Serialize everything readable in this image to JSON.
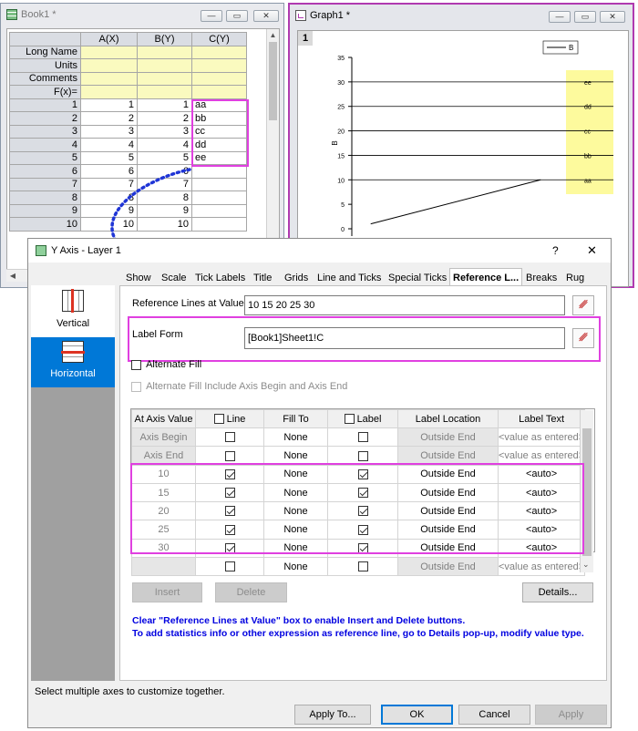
{
  "book": {
    "title": "Book1 *",
    "columns": [
      "A(X)",
      "B(Y)",
      "C(Y)"
    ],
    "meta_rows": [
      "Long Name",
      "Units",
      "Comments",
      "F(x)="
    ],
    "rows": [
      {
        "n": "1",
        "a": "1",
        "b": "1",
        "c": "aa"
      },
      {
        "n": "2",
        "a": "2",
        "b": "2",
        "c": "bb"
      },
      {
        "n": "3",
        "a": "3",
        "b": "3",
        "c": "cc"
      },
      {
        "n": "4",
        "a": "4",
        "b": "4",
        "c": "dd"
      },
      {
        "n": "5",
        "a": "5",
        "b": "5",
        "c": "ee"
      },
      {
        "n": "6",
        "a": "6",
        "b": "6",
        "c": ""
      },
      {
        "n": "7",
        "a": "7",
        "b": "7",
        "c": ""
      },
      {
        "n": "8",
        "a": "8",
        "b": "8",
        "c": ""
      },
      {
        "n": "9",
        "a": "9",
        "b": "9",
        "c": ""
      },
      {
        "n": "10",
        "a": "10",
        "b": "10",
        "c": ""
      }
    ]
  },
  "graph": {
    "title": "Graph1 *",
    "layer": "1",
    "legend": "B",
    "ylabel": "B",
    "yticks": [
      "35",
      "30",
      "25",
      "20",
      "15",
      "10",
      "5",
      "0"
    ],
    "ref_labels": [
      "ee",
      "dd",
      "cc",
      "bb",
      "aa"
    ]
  },
  "chart_data": {
    "type": "line",
    "series": [
      {
        "name": "B",
        "x": [
          1,
          10
        ],
        "y": [
          1,
          10
        ]
      }
    ],
    "ylabel": "B",
    "ylim": [
      0,
      35
    ],
    "reference_lines": [
      10,
      15,
      20,
      25,
      30
    ],
    "reference_labels": [
      "aa",
      "bb",
      "cc",
      "dd",
      "ee"
    ]
  },
  "dialog": {
    "title": "Y Axis - Layer 1",
    "help": "?",
    "close": "✕",
    "sidebar": [
      "Vertical",
      "Horizontal"
    ],
    "tabs": [
      "Show",
      "Scale",
      "Tick Labels",
      "Title",
      "Grids",
      "Line and Ticks",
      "Special Ticks",
      "Reference L...",
      "Breaks",
      "Rug"
    ],
    "ref_lines_label": "Reference Lines at Value",
    "ref_lines_value": "10 15 20 25 30",
    "label_form_label": "Label Form",
    "label_form_value": "[Book1]Sheet1!C",
    "alt_fill": "Alternate Fill",
    "alt_fill_include": "Alternate Fill Include Axis Begin and Axis End",
    "table_headers": [
      "At Axis Value",
      "Line",
      "Fill To",
      "Label",
      "Label Location",
      "Label Text"
    ],
    "table_rows": [
      {
        "at": "Axis Begin",
        "line": false,
        "fill": "None",
        "label": false,
        "loc": "Outside End",
        "text": "<value as entered>",
        "grey": true
      },
      {
        "at": "Axis End",
        "line": false,
        "fill": "None",
        "label": false,
        "loc": "Outside End",
        "text": "<value as entered>",
        "grey": true
      },
      {
        "at": "10",
        "line": true,
        "fill": "None",
        "label": true,
        "loc": "Outside End",
        "text": "<auto>",
        "grey": false
      },
      {
        "at": "15",
        "line": true,
        "fill": "None",
        "label": true,
        "loc": "Outside End",
        "text": "<auto>",
        "grey": false
      },
      {
        "at": "20",
        "line": true,
        "fill": "None",
        "label": true,
        "loc": "Outside End",
        "text": "<auto>",
        "grey": false
      },
      {
        "at": "25",
        "line": true,
        "fill": "None",
        "label": true,
        "loc": "Outside End",
        "text": "<auto>",
        "grey": false
      },
      {
        "at": "30",
        "line": true,
        "fill": "None",
        "label": true,
        "loc": "Outside End",
        "text": "<auto>",
        "grey": false
      },
      {
        "at": "",
        "line": false,
        "fill": "None",
        "label": false,
        "loc": "Outside End",
        "text": "<value as entered>",
        "grey": true
      }
    ],
    "insert": "Insert",
    "delete": "Delete",
    "details": "Details...",
    "note1": "Clear \"Reference Lines at Value\" box to enable Insert and Delete buttons.",
    "note2": "To add statistics info or other expression as reference line, go to Details pop-up, modify value type.",
    "status": "Select multiple axes to customize together.",
    "apply_to": "Apply To...",
    "ok": "OK",
    "cancel": "Cancel",
    "apply": "Apply"
  },
  "colors": {
    "highlight": "#e040e0",
    "note": "#0000e0",
    "selected": "#0078d7"
  }
}
